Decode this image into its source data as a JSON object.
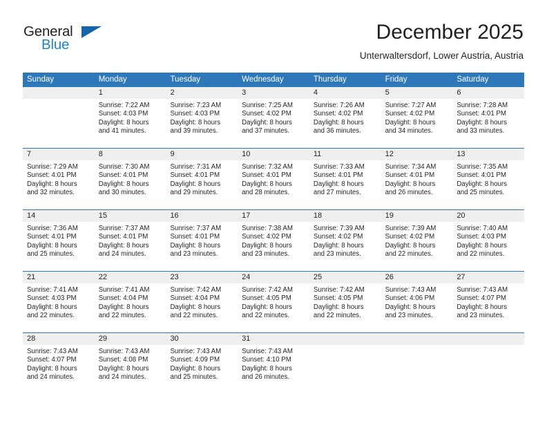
{
  "brand": {
    "name_top": "General",
    "name_bottom": "Blue",
    "accent_color": "#2e78b9",
    "logo_text_color": "#231f20",
    "logo_blue_color": "#2383c4"
  },
  "header": {
    "title": "December 2025",
    "subtitle": "Unterwaltersdorf, Lower Austria, Austria"
  },
  "calendar": {
    "weekdays": [
      "Sunday",
      "Monday",
      "Tuesday",
      "Wednesday",
      "Thursday",
      "Friday",
      "Saturday"
    ],
    "header_bg": "#2e78b9",
    "daynum_bg": "#efefef",
    "weeks": [
      [
        {
          "day": "",
          "lines": []
        },
        {
          "day": "1",
          "lines": [
            "Sunrise: 7:22 AM",
            "Sunset: 4:03 PM",
            "Daylight: 8 hours",
            "and 41 minutes."
          ]
        },
        {
          "day": "2",
          "lines": [
            "Sunrise: 7:23 AM",
            "Sunset: 4:03 PM",
            "Daylight: 8 hours",
            "and 39 minutes."
          ]
        },
        {
          "day": "3",
          "lines": [
            "Sunrise: 7:25 AM",
            "Sunset: 4:02 PM",
            "Daylight: 8 hours",
            "and 37 minutes."
          ]
        },
        {
          "day": "4",
          "lines": [
            "Sunrise: 7:26 AM",
            "Sunset: 4:02 PM",
            "Daylight: 8 hours",
            "and 36 minutes."
          ]
        },
        {
          "day": "5",
          "lines": [
            "Sunrise: 7:27 AM",
            "Sunset: 4:02 PM",
            "Daylight: 8 hours",
            "and 34 minutes."
          ]
        },
        {
          "day": "6",
          "lines": [
            "Sunrise: 7:28 AM",
            "Sunset: 4:01 PM",
            "Daylight: 8 hours",
            "and 33 minutes."
          ]
        }
      ],
      [
        {
          "day": "7",
          "lines": [
            "Sunrise: 7:29 AM",
            "Sunset: 4:01 PM",
            "Daylight: 8 hours",
            "and 32 minutes."
          ]
        },
        {
          "day": "8",
          "lines": [
            "Sunrise: 7:30 AM",
            "Sunset: 4:01 PM",
            "Daylight: 8 hours",
            "and 30 minutes."
          ]
        },
        {
          "day": "9",
          "lines": [
            "Sunrise: 7:31 AM",
            "Sunset: 4:01 PM",
            "Daylight: 8 hours",
            "and 29 minutes."
          ]
        },
        {
          "day": "10",
          "lines": [
            "Sunrise: 7:32 AM",
            "Sunset: 4:01 PM",
            "Daylight: 8 hours",
            "and 28 minutes."
          ]
        },
        {
          "day": "11",
          "lines": [
            "Sunrise: 7:33 AM",
            "Sunset: 4:01 PM",
            "Daylight: 8 hours",
            "and 27 minutes."
          ]
        },
        {
          "day": "12",
          "lines": [
            "Sunrise: 7:34 AM",
            "Sunset: 4:01 PM",
            "Daylight: 8 hours",
            "and 26 minutes."
          ]
        },
        {
          "day": "13",
          "lines": [
            "Sunrise: 7:35 AM",
            "Sunset: 4:01 PM",
            "Daylight: 8 hours",
            "and 25 minutes."
          ]
        }
      ],
      [
        {
          "day": "14",
          "lines": [
            "Sunrise: 7:36 AM",
            "Sunset: 4:01 PM",
            "Daylight: 8 hours",
            "and 25 minutes."
          ]
        },
        {
          "day": "15",
          "lines": [
            "Sunrise: 7:37 AM",
            "Sunset: 4:01 PM",
            "Daylight: 8 hours",
            "and 24 minutes."
          ]
        },
        {
          "day": "16",
          "lines": [
            "Sunrise: 7:37 AM",
            "Sunset: 4:01 PM",
            "Daylight: 8 hours",
            "and 23 minutes."
          ]
        },
        {
          "day": "17",
          "lines": [
            "Sunrise: 7:38 AM",
            "Sunset: 4:02 PM",
            "Daylight: 8 hours",
            "and 23 minutes."
          ]
        },
        {
          "day": "18",
          "lines": [
            "Sunrise: 7:39 AM",
            "Sunset: 4:02 PM",
            "Daylight: 8 hours",
            "and 23 minutes."
          ]
        },
        {
          "day": "19",
          "lines": [
            "Sunrise: 7:39 AM",
            "Sunset: 4:02 PM",
            "Daylight: 8 hours",
            "and 22 minutes."
          ]
        },
        {
          "day": "20",
          "lines": [
            "Sunrise: 7:40 AM",
            "Sunset: 4:03 PM",
            "Daylight: 8 hours",
            "and 22 minutes."
          ]
        }
      ],
      [
        {
          "day": "21",
          "lines": [
            "Sunrise: 7:41 AM",
            "Sunset: 4:03 PM",
            "Daylight: 8 hours",
            "and 22 minutes."
          ]
        },
        {
          "day": "22",
          "lines": [
            "Sunrise: 7:41 AM",
            "Sunset: 4:04 PM",
            "Daylight: 8 hours",
            "and 22 minutes."
          ]
        },
        {
          "day": "23",
          "lines": [
            "Sunrise: 7:42 AM",
            "Sunset: 4:04 PM",
            "Daylight: 8 hours",
            "and 22 minutes."
          ]
        },
        {
          "day": "24",
          "lines": [
            "Sunrise: 7:42 AM",
            "Sunset: 4:05 PM",
            "Daylight: 8 hours",
            "and 22 minutes."
          ]
        },
        {
          "day": "25",
          "lines": [
            "Sunrise: 7:42 AM",
            "Sunset: 4:05 PM",
            "Daylight: 8 hours",
            "and 22 minutes."
          ]
        },
        {
          "day": "26",
          "lines": [
            "Sunrise: 7:43 AM",
            "Sunset: 4:06 PM",
            "Daylight: 8 hours",
            "and 23 minutes."
          ]
        },
        {
          "day": "27",
          "lines": [
            "Sunrise: 7:43 AM",
            "Sunset: 4:07 PM",
            "Daylight: 8 hours",
            "and 23 minutes."
          ]
        }
      ],
      [
        {
          "day": "28",
          "lines": [
            "Sunrise: 7:43 AM",
            "Sunset: 4:07 PM",
            "Daylight: 8 hours",
            "and 24 minutes."
          ]
        },
        {
          "day": "29",
          "lines": [
            "Sunrise: 7:43 AM",
            "Sunset: 4:08 PM",
            "Daylight: 8 hours",
            "and 24 minutes."
          ]
        },
        {
          "day": "30",
          "lines": [
            "Sunrise: 7:43 AM",
            "Sunset: 4:09 PM",
            "Daylight: 8 hours",
            "and 25 minutes."
          ]
        },
        {
          "day": "31",
          "lines": [
            "Sunrise: 7:43 AM",
            "Sunset: 4:10 PM",
            "Daylight: 8 hours",
            "and 26 minutes."
          ]
        },
        {
          "day": "",
          "lines": []
        },
        {
          "day": "",
          "lines": []
        },
        {
          "day": "",
          "lines": []
        }
      ]
    ]
  }
}
